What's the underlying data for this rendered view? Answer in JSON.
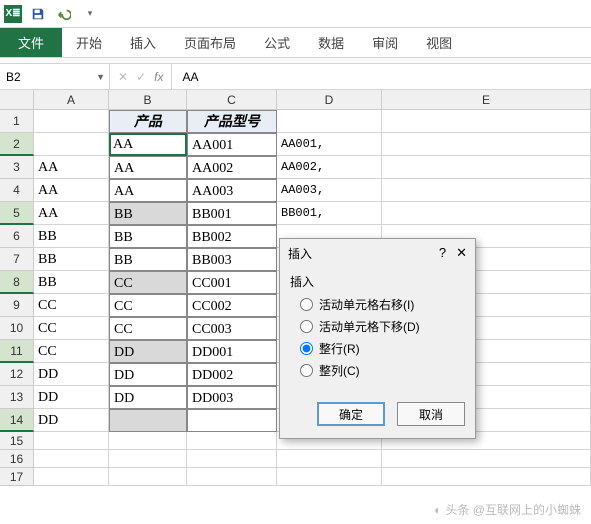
{
  "qat": {
    "excel_label": "X≣"
  },
  "tabs": {
    "file": "文件",
    "home": "开始",
    "insert": "插入",
    "layout": "页面布局",
    "formulas": "公式",
    "data": "数据",
    "review": "审阅",
    "view": "视图"
  },
  "namebox": {
    "value": "B2"
  },
  "formula": {
    "fx": "fx",
    "value": "AA"
  },
  "cols": [
    "A",
    "B",
    "C",
    "D",
    "E"
  ],
  "headers": {
    "B1": "产品",
    "C1": "产品型号"
  },
  "rows": [
    {
      "n": "1",
      "A": "",
      "B": "",
      "C": "",
      "D": ""
    },
    {
      "n": "2",
      "A": "",
      "B": "AA",
      "C": "AA001",
      "D": "AA001,"
    },
    {
      "n": "3",
      "A": "AA",
      "B": "AA",
      "C": "AA002",
      "D": "AA002,"
    },
    {
      "n": "4",
      "A": "AA",
      "B": "AA",
      "C": "AA003",
      "D": "AA003,"
    },
    {
      "n": "5",
      "A": "AA",
      "B": "BB",
      "C": "BB001",
      "D": "BB001,"
    },
    {
      "n": "6",
      "A": "BB",
      "B": "BB",
      "C": "BB002",
      "D": ""
    },
    {
      "n": "7",
      "A": "BB",
      "B": "BB",
      "C": "BB003",
      "D": ""
    },
    {
      "n": "8",
      "A": "BB",
      "B": "CC",
      "C": "CC001",
      "D": ""
    },
    {
      "n": "9",
      "A": "CC",
      "B": "CC",
      "C": "CC002",
      "D": ""
    },
    {
      "n": "10",
      "A": "CC",
      "B": "CC",
      "C": "CC003",
      "D": ""
    },
    {
      "n": "11",
      "A": "CC",
      "B": "DD",
      "C": "DD001",
      "D": ""
    },
    {
      "n": "12",
      "A": "DD",
      "B": "DD",
      "C": "DD002",
      "D": ""
    },
    {
      "n": "13",
      "A": "DD",
      "B": "DD",
      "C": "DD003",
      "D": ""
    },
    {
      "n": "14",
      "A": "DD",
      "B": "",
      "C": "",
      "D": ""
    },
    {
      "n": "15",
      "A": "",
      "B": "",
      "C": "",
      "D": ""
    },
    {
      "n": "16",
      "A": "",
      "B": "",
      "C": "",
      "D": ""
    },
    {
      "n": "17",
      "A": "",
      "B": "",
      "C": "",
      "D": ""
    }
  ],
  "selected_rows": [
    "2",
    "5",
    "8",
    "11",
    "14"
  ],
  "shaded_b": [
    "5",
    "8",
    "11",
    "14"
  ],
  "dialog": {
    "title": "插入",
    "help": "?",
    "close": "✕",
    "group_label": "插入",
    "options": {
      "shift_right": "活动单元格右移(I)",
      "shift_down": "活动单元格下移(D)",
      "entire_row": "整行(R)",
      "entire_col": "整列(C)"
    },
    "selected": "entire_row",
    "ok": "确定",
    "cancel": "取消"
  },
  "watermark": "头条 @互联网上的小蜘蛛"
}
